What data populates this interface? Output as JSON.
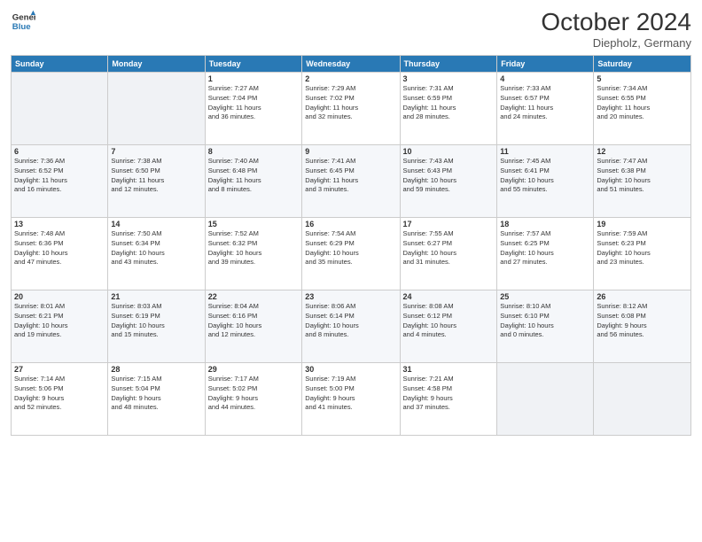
{
  "header": {
    "logo_line1": "General",
    "logo_line2": "Blue",
    "month": "October 2024",
    "location": "Diepholz, Germany"
  },
  "weekdays": [
    "Sunday",
    "Monday",
    "Tuesday",
    "Wednesday",
    "Thursday",
    "Friday",
    "Saturday"
  ],
  "weeks": [
    [
      {
        "day": "",
        "info": ""
      },
      {
        "day": "",
        "info": ""
      },
      {
        "day": "1",
        "info": "Sunrise: 7:27 AM\nSunset: 7:04 PM\nDaylight: 11 hours\nand 36 minutes."
      },
      {
        "day": "2",
        "info": "Sunrise: 7:29 AM\nSunset: 7:02 PM\nDaylight: 11 hours\nand 32 minutes."
      },
      {
        "day": "3",
        "info": "Sunrise: 7:31 AM\nSunset: 6:59 PM\nDaylight: 11 hours\nand 28 minutes."
      },
      {
        "day": "4",
        "info": "Sunrise: 7:33 AM\nSunset: 6:57 PM\nDaylight: 11 hours\nand 24 minutes."
      },
      {
        "day": "5",
        "info": "Sunrise: 7:34 AM\nSunset: 6:55 PM\nDaylight: 11 hours\nand 20 minutes."
      }
    ],
    [
      {
        "day": "6",
        "info": "Sunrise: 7:36 AM\nSunset: 6:52 PM\nDaylight: 11 hours\nand 16 minutes."
      },
      {
        "day": "7",
        "info": "Sunrise: 7:38 AM\nSunset: 6:50 PM\nDaylight: 11 hours\nand 12 minutes."
      },
      {
        "day": "8",
        "info": "Sunrise: 7:40 AM\nSunset: 6:48 PM\nDaylight: 11 hours\nand 8 minutes."
      },
      {
        "day": "9",
        "info": "Sunrise: 7:41 AM\nSunset: 6:45 PM\nDaylight: 11 hours\nand 3 minutes."
      },
      {
        "day": "10",
        "info": "Sunrise: 7:43 AM\nSunset: 6:43 PM\nDaylight: 10 hours\nand 59 minutes."
      },
      {
        "day": "11",
        "info": "Sunrise: 7:45 AM\nSunset: 6:41 PM\nDaylight: 10 hours\nand 55 minutes."
      },
      {
        "day": "12",
        "info": "Sunrise: 7:47 AM\nSunset: 6:38 PM\nDaylight: 10 hours\nand 51 minutes."
      }
    ],
    [
      {
        "day": "13",
        "info": "Sunrise: 7:48 AM\nSunset: 6:36 PM\nDaylight: 10 hours\nand 47 minutes."
      },
      {
        "day": "14",
        "info": "Sunrise: 7:50 AM\nSunset: 6:34 PM\nDaylight: 10 hours\nand 43 minutes."
      },
      {
        "day": "15",
        "info": "Sunrise: 7:52 AM\nSunset: 6:32 PM\nDaylight: 10 hours\nand 39 minutes."
      },
      {
        "day": "16",
        "info": "Sunrise: 7:54 AM\nSunset: 6:29 PM\nDaylight: 10 hours\nand 35 minutes."
      },
      {
        "day": "17",
        "info": "Sunrise: 7:55 AM\nSunset: 6:27 PM\nDaylight: 10 hours\nand 31 minutes."
      },
      {
        "day": "18",
        "info": "Sunrise: 7:57 AM\nSunset: 6:25 PM\nDaylight: 10 hours\nand 27 minutes."
      },
      {
        "day": "19",
        "info": "Sunrise: 7:59 AM\nSunset: 6:23 PM\nDaylight: 10 hours\nand 23 minutes."
      }
    ],
    [
      {
        "day": "20",
        "info": "Sunrise: 8:01 AM\nSunset: 6:21 PM\nDaylight: 10 hours\nand 19 minutes."
      },
      {
        "day": "21",
        "info": "Sunrise: 8:03 AM\nSunset: 6:19 PM\nDaylight: 10 hours\nand 15 minutes."
      },
      {
        "day": "22",
        "info": "Sunrise: 8:04 AM\nSunset: 6:16 PM\nDaylight: 10 hours\nand 12 minutes."
      },
      {
        "day": "23",
        "info": "Sunrise: 8:06 AM\nSunset: 6:14 PM\nDaylight: 10 hours\nand 8 minutes."
      },
      {
        "day": "24",
        "info": "Sunrise: 8:08 AM\nSunset: 6:12 PM\nDaylight: 10 hours\nand 4 minutes."
      },
      {
        "day": "25",
        "info": "Sunrise: 8:10 AM\nSunset: 6:10 PM\nDaylight: 10 hours\nand 0 minutes."
      },
      {
        "day": "26",
        "info": "Sunrise: 8:12 AM\nSunset: 6:08 PM\nDaylight: 9 hours\nand 56 minutes."
      }
    ],
    [
      {
        "day": "27",
        "info": "Sunrise: 7:14 AM\nSunset: 5:06 PM\nDaylight: 9 hours\nand 52 minutes."
      },
      {
        "day": "28",
        "info": "Sunrise: 7:15 AM\nSunset: 5:04 PM\nDaylight: 9 hours\nand 48 minutes."
      },
      {
        "day": "29",
        "info": "Sunrise: 7:17 AM\nSunset: 5:02 PM\nDaylight: 9 hours\nand 44 minutes."
      },
      {
        "day": "30",
        "info": "Sunrise: 7:19 AM\nSunset: 5:00 PM\nDaylight: 9 hours\nand 41 minutes."
      },
      {
        "day": "31",
        "info": "Sunrise: 7:21 AM\nSunset: 4:58 PM\nDaylight: 9 hours\nand 37 minutes."
      },
      {
        "day": "",
        "info": ""
      },
      {
        "day": "",
        "info": ""
      }
    ]
  ]
}
